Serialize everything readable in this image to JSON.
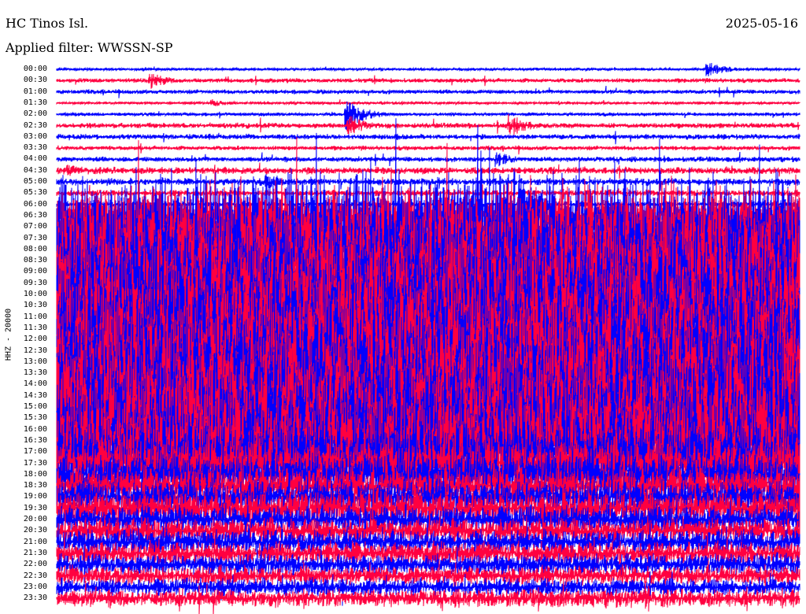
{
  "header": {
    "station": "HC Tinos Isl.",
    "date": "2025-05-16",
    "filter": "Applied filter: WWSSN-SP"
  },
  "chart_data": {
    "type": "line",
    "title": "HC Tinos Isl.",
    "ylabel": "HHZ - 20000",
    "row_minutes": 30,
    "colors": [
      "#0000ff",
      "#ff0040"
    ],
    "row_labels": [
      "00:00",
      "00:30",
      "01:00",
      "01:30",
      "02:00",
      "02:30",
      "03:00",
      "03:30",
      "04:00",
      "04:30",
      "05:00",
      "05:30",
      "06:00",
      "06:30",
      "07:00",
      "07:30",
      "08:00",
      "08:30",
      "09:00",
      "09:30",
      "10:00",
      "10:30",
      "11:00",
      "11:30",
      "12:00",
      "12:30",
      "13:00",
      "13:30",
      "14:00",
      "14:30",
      "15:00",
      "15:30",
      "16:00",
      "16:30",
      "17:00",
      "17:30",
      "18:00",
      "18:30",
      "19:00",
      "19:30",
      "20:00",
      "20:30",
      "21:00",
      "21:30",
      "22:00",
      "22:30",
      "23:00",
      "23:30"
    ],
    "relative_amplitude": [
      1.5,
      2.5,
      2.5,
      1.5,
      2,
      3,
      3,
      2.5,
      3,
      4,
      4,
      3.5,
      3,
      20,
      60,
      60,
      60,
      60,
      60,
      60,
      60,
      60,
      60,
      60,
      60,
      60,
      60,
      60,
      60,
      60,
      60,
      60,
      55,
      50,
      40,
      30,
      25,
      22,
      20,
      20,
      16,
      15,
      14,
      13,
      12,
      11,
      10,
      10
    ],
    "events": [
      {
        "row": 0,
        "minute": 26.3,
        "amplitude": 10
      },
      {
        "row": 1,
        "minute": 3.8,
        "amplitude": 12
      },
      {
        "row": 3,
        "minute": 6.3,
        "amplitude": 5
      },
      {
        "row": 4,
        "minute": 11.7,
        "amplitude": 20
      },
      {
        "row": 5,
        "minute": 11.8,
        "amplitude": 15
      },
      {
        "row": 5,
        "minute": 18.3,
        "amplitude": 15
      },
      {
        "row": 8,
        "minute": 17.8,
        "amplitude": 10
      },
      {
        "row": 9,
        "minute": 0.5,
        "amplitude": 8
      },
      {
        "row": 10,
        "minute": 8.5,
        "amplitude": 10
      },
      {
        "row": 12,
        "minute": 18.7,
        "amplitude": 40
      }
    ]
  }
}
